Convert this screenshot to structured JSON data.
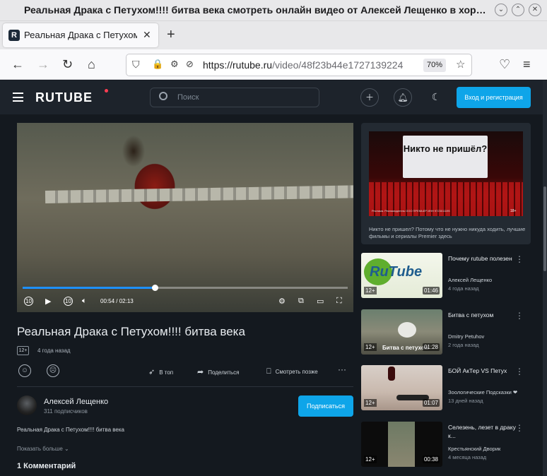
{
  "window": {
    "title": "Реальная Драка с Петухом!!!! битва века смотреть онлайн видео от Алексей Лещенко в хороше...",
    "controls": [
      "⌄",
      "⌃",
      "✕"
    ]
  },
  "tab": {
    "label": "Реальная Драка с Петухом!!!!",
    "favicon": "R",
    "close": "✕"
  },
  "newtab": "+",
  "nav": {
    "url_host": "https://rutube.ru",
    "url_path": "/video/48f23b44e1727139224",
    "zoom": "70%"
  },
  "site": {
    "logo": "RUTUBE",
    "search_placeholder": "Поиск",
    "login": "Вход и регистрация",
    "colors": {
      "accent": "#0ea5e9",
      "logo_dot": "#ff3d52",
      "progress": "#1e90ff"
    }
  },
  "player": {
    "current": "00:54",
    "duration": "02:13",
    "progress_fraction": 0.406,
    "rewind_label": "10",
    "forward_label": "10"
  },
  "video": {
    "title": "Реальная Драка с Петухом!!!! битва века",
    "age": "12+",
    "date": "4 года назад",
    "actions": {
      "top": "В топ",
      "share": "Поделиться",
      "later": "Смотреть позже"
    },
    "channel": {
      "name": "Алексей Лещенко",
      "subs": "311 подписчиков"
    },
    "subscribe": "Подписаться",
    "description": "Реальная Драка с Петухом!!!! битва века",
    "show_more": "Показать больше",
    "comments": "1 Комментарий"
  },
  "ad": {
    "screen_text": "Никто не пришёл?",
    "small_print": "Реклама. Рекламодатель ООО ПРЕМЬЕР ИНН 9723011195",
    "age": "18+",
    "caption": "Никто не пришел? Потому что не нужно никуда ходить, лучшие фильмы и сериалы Premier здесь"
  },
  "recs": [
    {
      "title": "Почему rutube полезен",
      "channel": "Алексей Лещенко",
      "date": "4 года назад",
      "age": "12+",
      "duration": "01:46",
      "thumb_text": "RuTube"
    },
    {
      "title": "Битва с петухом",
      "channel": "Dmitry Petuhov",
      "date": "2 года назад",
      "age": "12+",
      "duration": "01:28",
      "thumb_text": "Битва с петухом"
    },
    {
      "title": "БОЙ АкТер VS Петух",
      "channel": "Зоологические Подсказки ❤",
      "date": "13 дней назад",
      "age": "12+",
      "duration": "01:07",
      "thumb_text": ""
    },
    {
      "title": "Селезень, лезет в драку к...",
      "channel": "Крестьянский Дворик",
      "date": "4 месяца назад",
      "age": "12+",
      "duration": "00:38",
      "thumb_text": ""
    }
  ]
}
